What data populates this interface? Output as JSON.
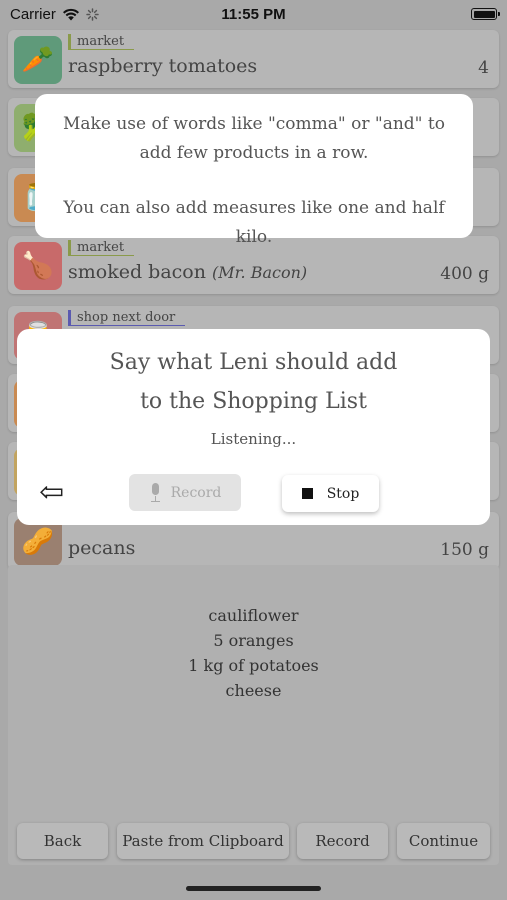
{
  "status_bar": {
    "carrier": "Carrier",
    "time": "11:55 PM",
    "battery_level": 1.0
  },
  "list": {
    "items": [
      {
        "tag": "market",
        "tag_color": "#8a9a4a",
        "name": "raspberry tomatoes",
        "brand": "",
        "qty": "4",
        "icon": "vegetables-icon",
        "icon_color": "#5f9a7a",
        "icon_glyph": "🥕"
      },
      {
        "tag": "",
        "tag_color": "#8a9a4a",
        "name": "",
        "brand": "",
        "qty": "",
        "icon": "vegetables-icon",
        "icon_color": "#8fae6e",
        "icon_glyph": "🥦"
      },
      {
        "tag": "",
        "tag_color": "#8a9a4a",
        "name": "",
        "brand": "",
        "qty": "",
        "icon": "jar-icon",
        "icon_color": "#c98a52",
        "icon_glyph": "🫙"
      },
      {
        "tag": "market",
        "tag_color": "#8a9a4a",
        "name": "smoked bacon",
        "brand": "(Mr. Bacon)",
        "qty": "400 g",
        "icon": "meat-icon",
        "icon_color": "#c86a6a",
        "icon_glyph": "🍗"
      },
      {
        "tag": "shop next door",
        "tag_color": "#5a5ab0",
        "name": "",
        "brand": "",
        "qty": "",
        "icon": "canned-food-icon",
        "icon_color": "#c07474",
        "icon_glyph": "🥫"
      },
      {
        "tag": "",
        "tag_color": "#5a5ab0",
        "name": "",
        "brand": "",
        "qty": "",
        "icon": "grocery-icon",
        "icon_color": "#c98a52",
        "icon_glyph": "🍞"
      },
      {
        "tag": "",
        "tag_color": "#5a5ab0",
        "name": "",
        "brand": "",
        "qty": "",
        "icon": "grocery-icon",
        "icon_color": "#c2a460",
        "icon_glyph": "🧀"
      },
      {
        "tag": "",
        "tag_color": "#5a5ab0",
        "name": "pecans",
        "brand": "",
        "qty": "150 g",
        "icon": "nuts-icon",
        "icon_color": "#9a8070",
        "icon_glyph": "🥜"
      }
    ]
  },
  "hint": {
    "line1": "Make use of words like \"comma\" or \"and\" to add few products in a row.",
    "line2": "You can also add measures like one and half kilo."
  },
  "voice_dialog": {
    "title_line1": "Say what Leni should add",
    "title_line2": "to the Shopping List",
    "status": "Listening...",
    "back_arrow": "⇦",
    "record_label": "Record",
    "stop_label": "Stop"
  },
  "input_panel": {
    "lines": [
      "cauliflower",
      "5 oranges",
      "1 kg of potatoes",
      "cheese"
    ]
  },
  "bottom_bar": {
    "back_label": "Back",
    "paste_label": "Paste from Clipboard",
    "record_label": "Record",
    "continue_label": "Continue"
  }
}
